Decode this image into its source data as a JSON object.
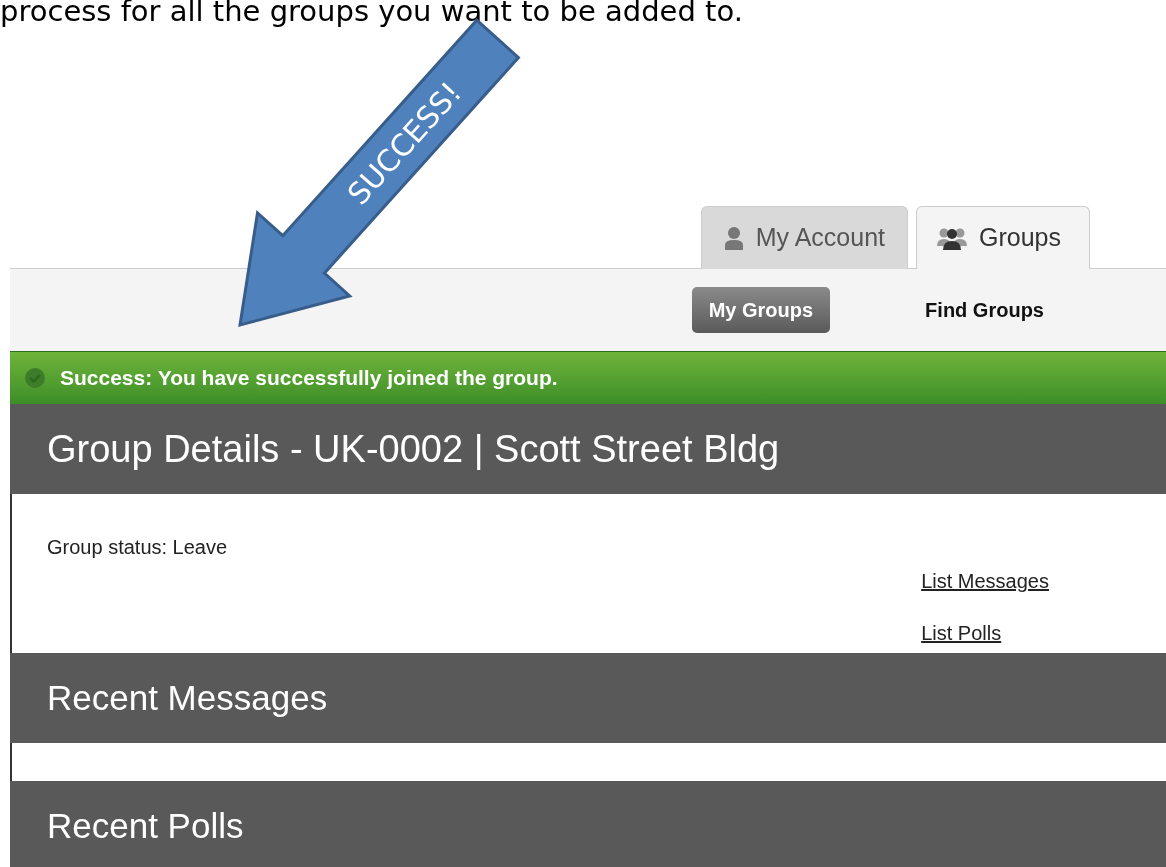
{
  "document_text": "process for all the groups you want to be added to.",
  "annotation": {
    "label": "SUCCESS!"
  },
  "tabs": [
    {
      "label": "My Account",
      "selected": false
    },
    {
      "label": "Groups",
      "selected": true
    }
  ],
  "subnav": [
    {
      "label": "My Groups",
      "selected": true
    },
    {
      "label": "Find Groups",
      "selected": false
    }
  ],
  "alert": {
    "kind": "success",
    "text": "Success: You have successfully joined the group."
  },
  "group": {
    "title": "Group Details - UK-0002 | Scott Street Bldg",
    "status": "Group status: Leave",
    "links": [
      "List Messages",
      "List Polls"
    ]
  },
  "sections": [
    {
      "title": "Recent Messages"
    },
    {
      "title": "Recent Polls"
    }
  ]
}
